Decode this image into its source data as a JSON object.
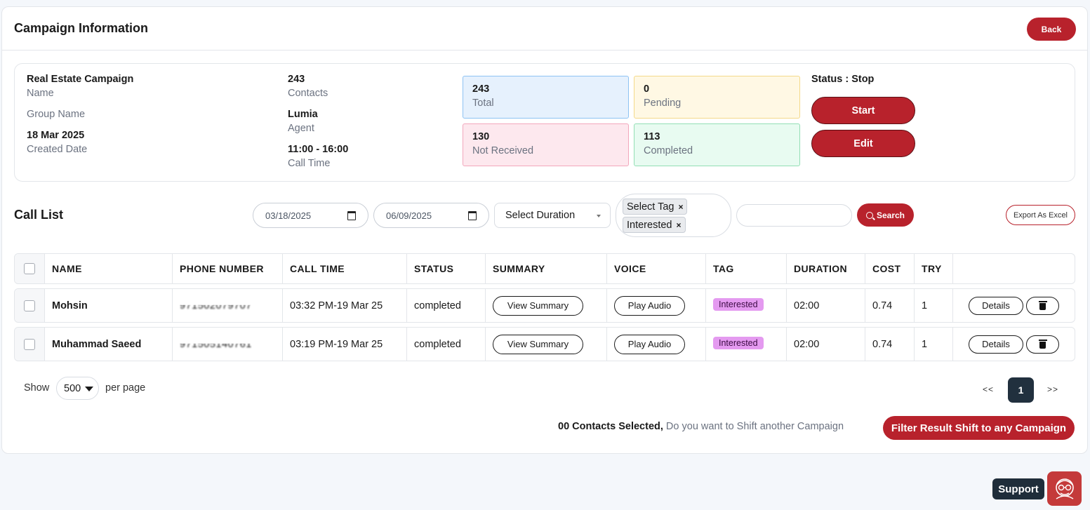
{
  "header": {
    "title": "Campaign Information",
    "back_label": "Back"
  },
  "info": {
    "campaign_name": "Real Estate Campaign",
    "name_label": "Name",
    "group_label": "Group Name",
    "created_date": "18 Mar 2025",
    "created_label": "Created Date",
    "contacts_count": "243",
    "contacts_label": "Contacts",
    "agent": "Lumia",
    "agent_label": "Agent",
    "call_time": "11:00 - 16:00",
    "call_time_label": "Call Time"
  },
  "stats": {
    "total": {
      "value": "243",
      "label": "Total"
    },
    "pending": {
      "value": "0",
      "label": "Pending"
    },
    "not_received": {
      "value": "130",
      "label": "Not Received"
    },
    "completed": {
      "value": "113",
      "label": "Completed"
    }
  },
  "status": {
    "text": "Status : Stop",
    "start_label": "Start",
    "edit_label": "Edit"
  },
  "call_list": {
    "title": "Call List",
    "date_from": "03/18/2025",
    "date_to": "06/09/2025",
    "duration_placeholder": "Select Duration",
    "tags": [
      "Select Tag",
      "Interested"
    ],
    "search_label": "Search",
    "export_label": "Export As Excel"
  },
  "table": {
    "columns": [
      "NAME",
      "PHONE NUMBER",
      "CALL TIME",
      "STATUS",
      "SUMMARY",
      "VOICE",
      "TAG",
      "DURATION",
      "COST",
      "TRY"
    ],
    "rows": [
      {
        "name": "Mohsin",
        "phone": "971502079707",
        "call_time": "03:32 PM-19 Mar 25",
        "status": "completed",
        "summary": "View Summary",
        "voice": "Play Audio",
        "tag": "Interested",
        "duration": "02:00",
        "cost": "0.74",
        "try": "1",
        "details": "Details"
      },
      {
        "name": "Muhammad Saeed",
        "phone": "971505140761",
        "call_time": "03:19 PM-19 Mar 25",
        "status": "completed",
        "summary": "View Summary",
        "voice": "Play Audio",
        "tag": "Interested",
        "duration": "02:00",
        "cost": "0.74",
        "try": "1",
        "details": "Details"
      }
    ]
  },
  "footer": {
    "show_label": "Show",
    "per_page_value": "500",
    "per_page_label": "per page",
    "prev_label": "<<",
    "page": "1",
    "next_label": ">>",
    "selected_count": "00 Contacts Selected,",
    "selected_question": " Do you want to Shift another Campaign",
    "shift_label": "Filter Result Shift to any Campaign"
  },
  "support": {
    "label": "Support"
  },
  "colors": {
    "accent": "#b8222c",
    "dark": "#21303e",
    "tag": "#e49af0"
  }
}
